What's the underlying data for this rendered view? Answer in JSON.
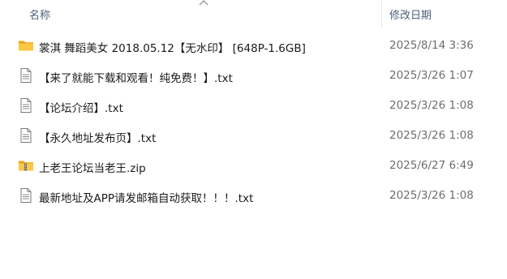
{
  "header": {
    "name_label": "名称",
    "date_label": "修改日期"
  },
  "files": [
    {
      "name": "裳淇 舞蹈美女 2018.05.12【无水印】 [648P-1.6GB]",
      "date": "2025/8/14 3:36",
      "icon": "folder-icon"
    },
    {
      "name": "【来了就能下载和观看！纯免费！】.txt",
      "date": "2025/3/26 1:07",
      "icon": "text-file-icon"
    },
    {
      "name": "【论坛介绍】.txt",
      "date": "2025/3/26 1:08",
      "icon": "text-file-icon"
    },
    {
      "name": "【永久地址发布页】.txt",
      "date": "2025/3/26 1:08",
      "icon": "text-file-icon"
    },
    {
      "name": "上老王论坛当老王.zip",
      "date": "2025/6/27 6:49",
      "icon": "zip-folder-icon"
    },
    {
      "name": "最新地址及APP请发邮箱自动获取！！！.txt",
      "date": "2025/3/26 1:08",
      "icon": "text-file-icon"
    }
  ]
}
